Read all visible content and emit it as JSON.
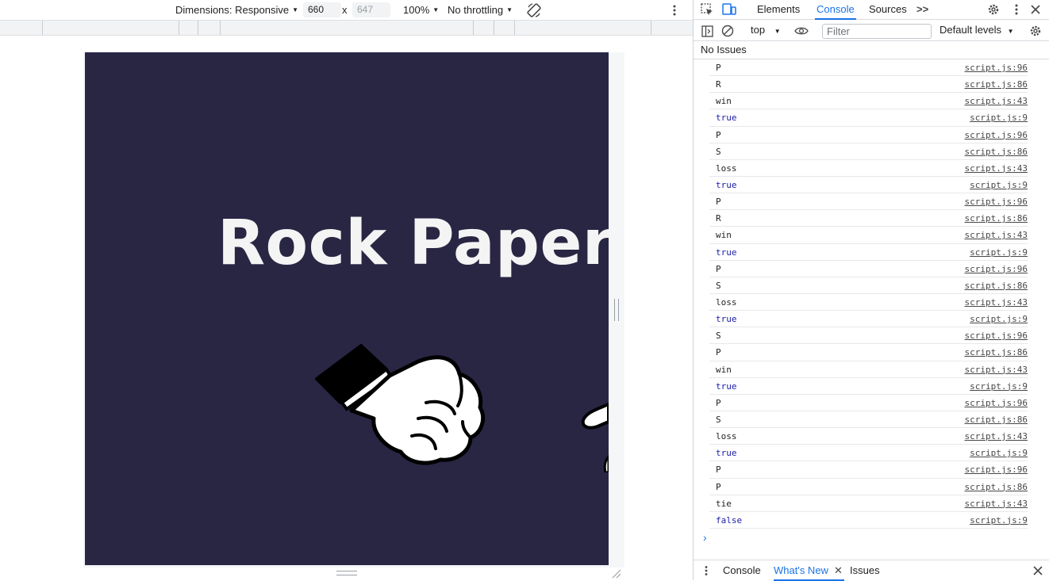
{
  "emulation_toolbar": {
    "dimensions_label": "Dimensions: Responsive",
    "width": "660",
    "times": "x",
    "height": "647",
    "zoom": "100%",
    "throttling": "No throttling",
    "rotate_icon": "rotate-icon",
    "more_icon": "more-vertical-icon"
  },
  "page": {
    "title": "Rock Paper",
    "background_color": "#292644",
    "title_color": "#f4f4f4"
  },
  "devtools": {
    "tabs": [
      "Elements",
      "Console",
      "Sources"
    ],
    "active_tab": "Console",
    "more_tabs": ">>",
    "context": "top",
    "filter_placeholder": "Filter",
    "levels": "Default levels",
    "issues": "No Issues",
    "logs": [
      {
        "msg": "P",
        "src": "script.js:96"
      },
      {
        "msg": "R",
        "src": "script.js:86"
      },
      {
        "msg": "win",
        "src": "script.js:43"
      },
      {
        "msg": "true",
        "src": "script.js:9"
      },
      {
        "msg": "P",
        "src": "script.js:96"
      },
      {
        "msg": "S",
        "src": "script.js:86"
      },
      {
        "msg": "loss",
        "src": "script.js:43"
      },
      {
        "msg": "true",
        "src": "script.js:9"
      },
      {
        "msg": "P",
        "src": "script.js:96"
      },
      {
        "msg": "R",
        "src": "script.js:86"
      },
      {
        "msg": "win",
        "src": "script.js:43"
      },
      {
        "msg": "true",
        "src": "script.js:9"
      },
      {
        "msg": "P",
        "src": "script.js:96"
      },
      {
        "msg": "S",
        "src": "script.js:86"
      },
      {
        "msg": "loss",
        "src": "script.js:43"
      },
      {
        "msg": "true",
        "src": "script.js:9"
      },
      {
        "msg": "S",
        "src": "script.js:96"
      },
      {
        "msg": "P",
        "src": "script.js:86"
      },
      {
        "msg": "win",
        "src": "script.js:43"
      },
      {
        "msg": "true",
        "src": "script.js:9"
      },
      {
        "msg": "P",
        "src": "script.js:96"
      },
      {
        "msg": "S",
        "src": "script.js:86"
      },
      {
        "msg": "loss",
        "src": "script.js:43"
      },
      {
        "msg": "true",
        "src": "script.js:9"
      },
      {
        "msg": "P",
        "src": "script.js:96"
      },
      {
        "msg": "P",
        "src": "script.js:86"
      },
      {
        "msg": "tie",
        "src": "script.js:43"
      },
      {
        "msg": "false",
        "src": "script.js:9"
      }
    ],
    "prompt": "›",
    "drawer_tabs": [
      "Console",
      "What's New",
      "Issues"
    ],
    "drawer_active": "What's New",
    "accent_color": "#1a73e8"
  }
}
